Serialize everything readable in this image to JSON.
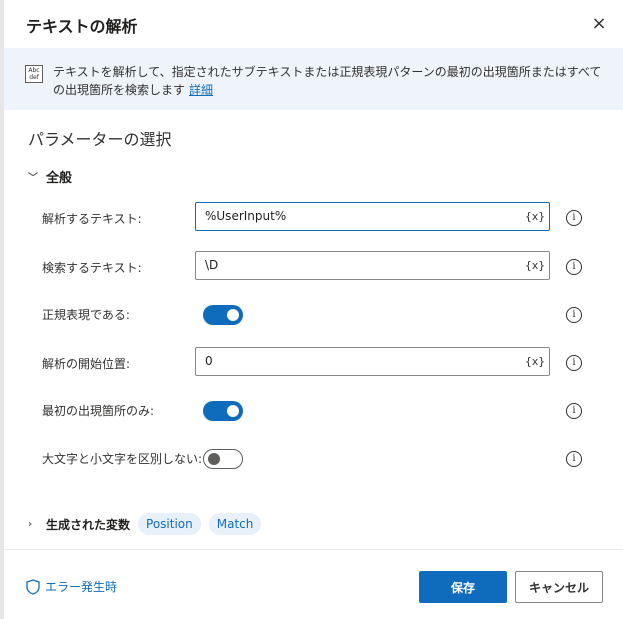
{
  "dialog": {
    "title": "テキストの解析",
    "close_icon": "×"
  },
  "info": {
    "icon_text": "Abc def",
    "description": "テキストを解析して、指定されたサブテキストまたは正規表現パターンの最初の出現箇所またはすべての出現箇所を検索します",
    "details_link": "詳細"
  },
  "section": {
    "title": "パラメーターの選択",
    "group_label": "全般",
    "group_chevron": "﹀"
  },
  "params": {
    "text_to_parse": {
      "label": "解析するテキスト:",
      "value": "%UserInput%",
      "var_button": "{x}"
    },
    "text_to_find": {
      "label": "検索するテキスト:",
      "value": "\\D",
      "var_button": "{x}"
    },
    "is_regex": {
      "label": "正規表現である:",
      "state": "on"
    },
    "start_position": {
      "label": "解析の開始位置:",
      "value": "0",
      "var_button": "{x}"
    },
    "first_only": {
      "label": "最初の出現箇所のみ:",
      "state": "on"
    },
    "ignore_case": {
      "label": "大文字と小文字を区別しない:",
      "state": "off"
    },
    "help_icon": "i"
  },
  "generated_vars": {
    "label": "生成された変数",
    "chevron": "›",
    "items": [
      "Position",
      "Match"
    ]
  },
  "footer": {
    "on_error_label": "エラー発生時",
    "save_label": "保存",
    "cancel_label": "キャンセル"
  },
  "colors": {
    "accent": "#0f6cbd",
    "info_bg": "#eff4fb"
  }
}
